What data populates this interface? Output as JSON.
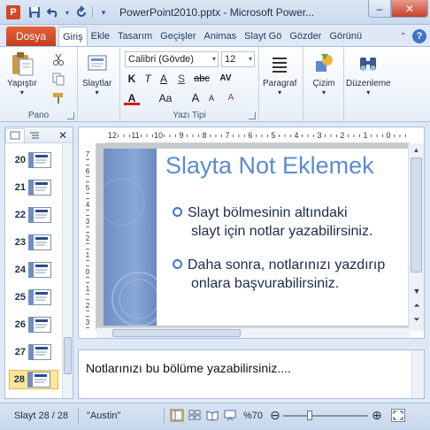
{
  "titlebar": {
    "app_icon": "P",
    "title": "PowerPoint2010.pptx - Microsoft Power...",
    "qat_icons": [
      "save-icon",
      "undo-icon",
      "redo-icon",
      "customize-icon"
    ],
    "minimize_label": "–",
    "close_label": "✕"
  },
  "tabs": {
    "file": "Dosya",
    "items": [
      "Giriş",
      "Ekle",
      "Tasarım",
      "Geçişler",
      "Animas",
      "Slayt Gö",
      "Gözder",
      "Görünü"
    ],
    "active": "Giriş",
    "minimize_ribbon_glyph": "⌃",
    "help": "?"
  },
  "ribbon": {
    "pano": {
      "label": "Pano",
      "paste": "Yapıştır"
    },
    "slaytlar": {
      "new_slide": "Slaytlar"
    },
    "font": {
      "label": "Yazı Tipi",
      "family": "Calibri (Gövde)",
      "size": "12",
      "bold": "K",
      "italic": "T",
      "underline": "A",
      "shadow": "S",
      "strike": "abc",
      "spacing": "AV",
      "color": "A",
      "case": "Aa",
      "grow": "A",
      "shrink": "A",
      "clear": "A"
    },
    "paragraph": "Paragraf",
    "drawing": "Çizim",
    "editing": "Düzenleme"
  },
  "slides_pane": {
    "numbers": [
      "20",
      "21",
      "22",
      "23",
      "24",
      "25",
      "26",
      "27",
      "28"
    ],
    "selected": "28"
  },
  "ruler": {
    "h_labels": [
      "12",
      "11",
      "10",
      "9",
      "8",
      "7",
      "6",
      "5",
      "4",
      "3",
      "2",
      "1",
      "0"
    ],
    "v_labels": [
      "7",
      "6",
      "5",
      "4",
      "3",
      "2",
      "1",
      "0",
      "1",
      "2",
      "3"
    ]
  },
  "slide": {
    "title": "Slayta Not Eklemek",
    "bullets": [
      {
        "line1": "Slayt   bölmesinin   altındaki",
        "line2": "slayt için notlar yazabilirsiniz."
      },
      {
        "line1": "Daha sonra, notlarınızı yazdırıp",
        "line2": "onlara başvurabilirsiniz."
      }
    ]
  },
  "notes": {
    "text": "Notlarınızı bu bölüme yazabilirsiniz...."
  },
  "status": {
    "slide_info": "Slayt 28 / 28",
    "theme": "\"Austin\"",
    "zoom": "%70",
    "zoom_level": 0.3
  },
  "colors": {
    "file_tab": "#d24726",
    "title_blue": "#5c8bd0",
    "bullet_ring": "#3f78c4",
    "selected_thumb": "#fde69b"
  }
}
